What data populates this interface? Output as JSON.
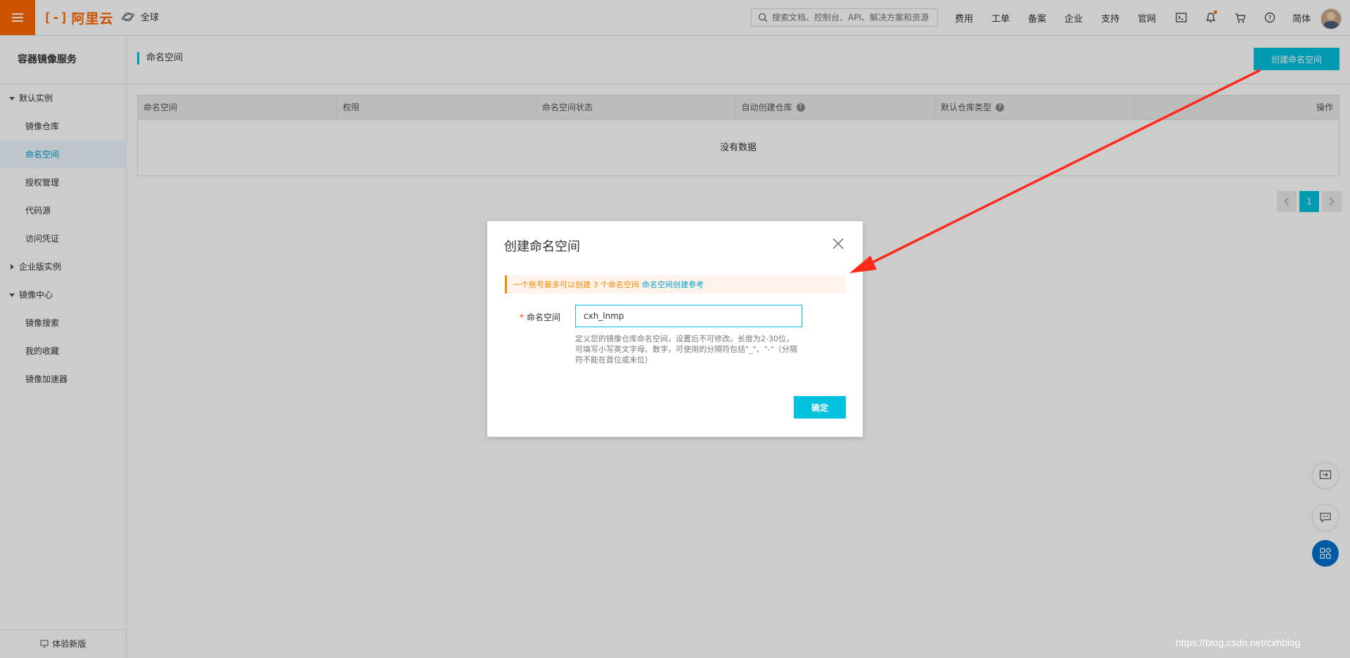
{
  "topbar": {
    "logo_text": "阿里云",
    "logo_mark": "[-]",
    "region": "全球",
    "search_placeholder": "搜索文档、控制台、API、解决方案和资源",
    "nav_items": [
      "费用",
      "工单",
      "备案",
      "企业",
      "支持",
      "官网"
    ],
    "language": "简体",
    "icons": [
      "terminal-icon",
      "bell-icon",
      "cart-icon",
      "help-icon"
    ]
  },
  "sidebar": {
    "title": "容器镜像服务",
    "groups": [
      {
        "label": "默认实例",
        "expanded": true,
        "items": [
          "镜像仓库",
          "命名空间",
          "授权管理",
          "代码源",
          "访问凭证"
        ]
      },
      {
        "label": "企业版实例",
        "expanded": false,
        "items": []
      },
      {
        "label": "镜像中心",
        "expanded": true,
        "items": [
          "镜像搜索",
          "我的收藏",
          "镜像加速器"
        ]
      }
    ],
    "active_item": "命名空间",
    "footer": "体验新版"
  },
  "main": {
    "title": "命名空间",
    "create_button": "创建命名空间",
    "columns": [
      "命名空间",
      "权限",
      "命名空间状态",
      "自动创建仓库",
      "默认仓库类型",
      "操作"
    ],
    "empty_text": "没有数据",
    "pagination": {
      "current": "1"
    }
  },
  "dialog": {
    "title": "创建命名空间",
    "alert_text": "一个账号最多可以创建 3 个命名空间",
    "alert_link": "命名空间创建参考",
    "field_label": "命名空间",
    "field_value": "cxh_lnmp",
    "help_text": "定义您的镜像仓库命名空间，设置后不可修改。长度为2-30位，可填写小写英文字母、数字，可使用的分隔符包括\"_\"、\"-\"（分隔符不能在首位或末位）",
    "confirm_button": "确定"
  },
  "watermark": "https://blog.csdn.net/cxhblog",
  "colors": {
    "brand": "#ff6a00",
    "primary": "#00c1de",
    "annotation_arrow": "#ff2a1a"
  }
}
